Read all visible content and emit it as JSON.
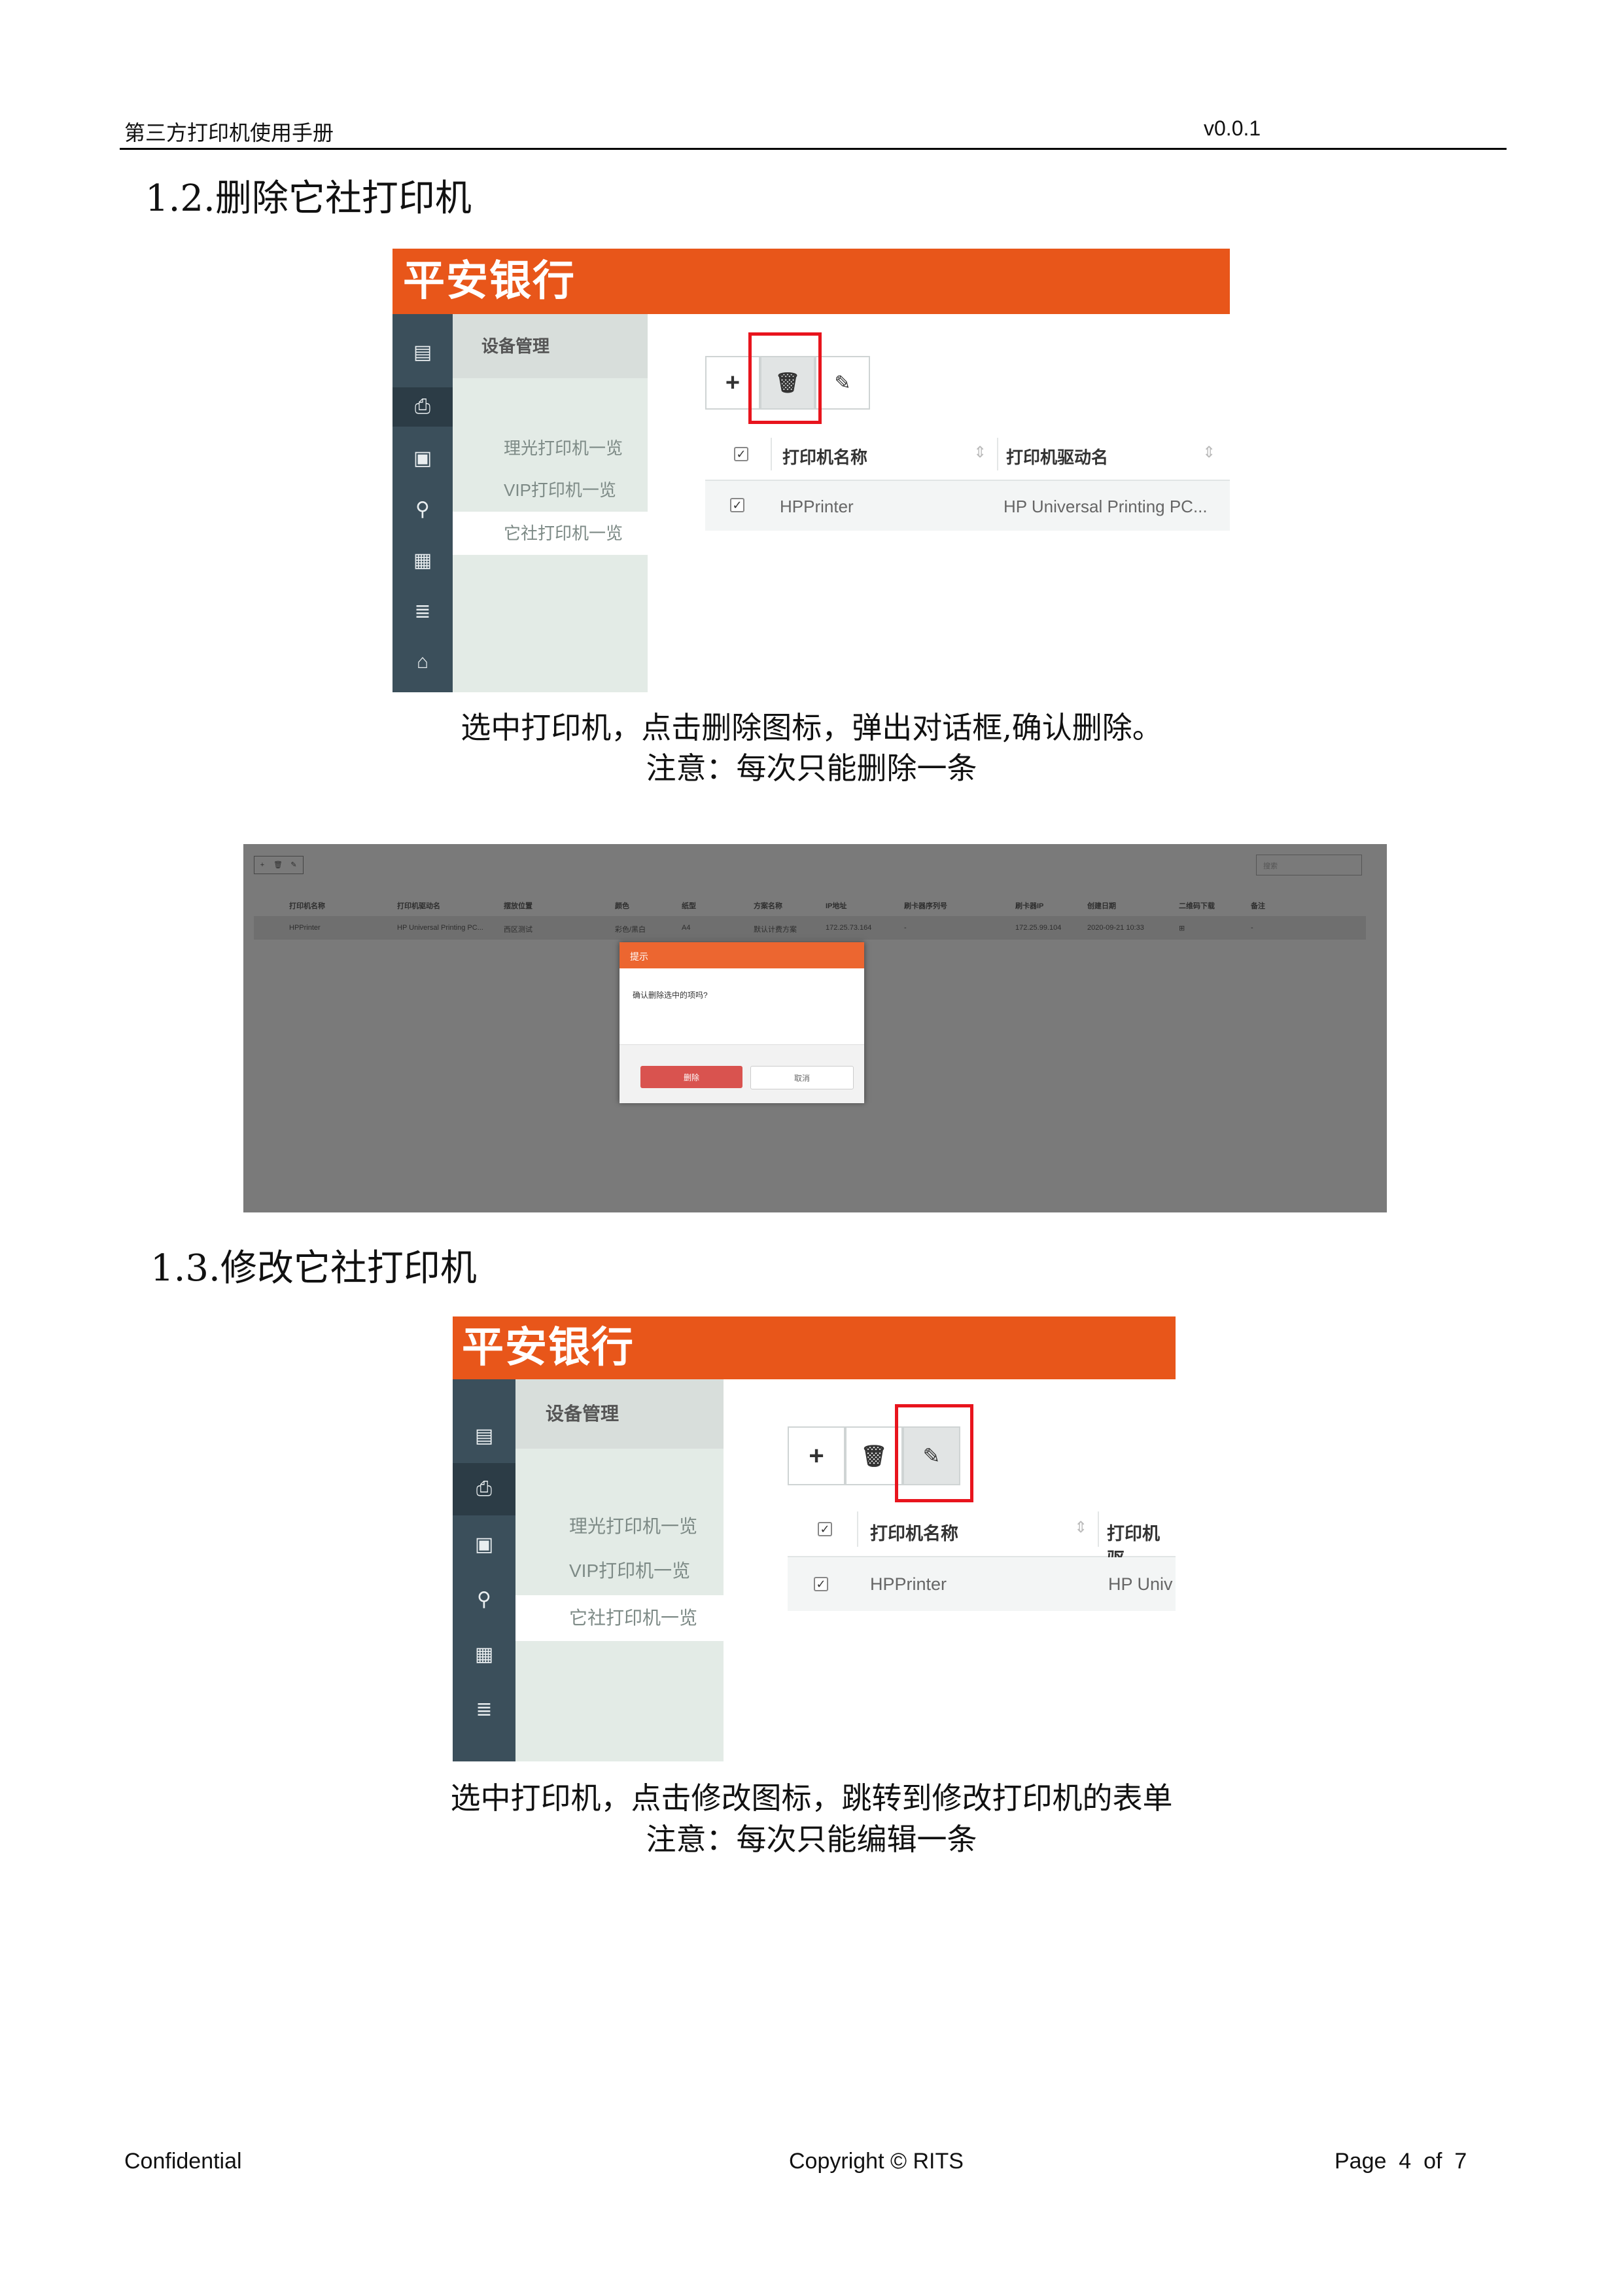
{
  "header": {
    "manual_title": "第三方打印机使用手册",
    "version": "v0.0.1"
  },
  "section_delete": {
    "heading": "1.2.删除它社打印机",
    "caption_line1": "选中打印机，点击删除图标，弹出对话框,确认删除。",
    "caption_line2": "注意：每次只能删除一条"
  },
  "section_edit": {
    "heading": "1.3.修改它社打印机",
    "caption_line1": "选中打印机，点击修改图标，跳转到修改打印机的表单",
    "caption_line2": "注意：每次只能编辑一条"
  },
  "app": {
    "brand": "平安银行",
    "menu_header": "设备管理",
    "menu_items": [
      "理光打印机一览",
      "VIP打印机一览",
      "它社打印机一览"
    ],
    "toolbar": {
      "add": "+",
      "delete": "🗑",
      "edit": "✎"
    },
    "table_headers": [
      "打印机名称",
      "打印机驱动名"
    ],
    "row": {
      "name": "HPPrinter",
      "driver": "HP Universal Printing PC..."
    },
    "edit_shot_header_trunc": "打印机驱",
    "edit_shot_driver_trunc": "HP Univ"
  },
  "dialog_shot": {
    "search_placeholder": "搜索",
    "headers": [
      "打印机名称",
      "打印机驱动名",
      "摆放位置",
      "颜色",
      "纸型",
      "方案名称",
      "IP地址",
      "刷卡器序列号",
      "刷卡器IP",
      "创建日期",
      "二维码下载",
      "备注"
    ],
    "row": [
      "HPPrinter",
      "HP Universal Printing PC...",
      "西区测试",
      "彩色/黑白",
      "A4",
      "默认计费方案",
      "172.25.73.164",
      "-",
      "172.25.99.104",
      "2020-09-21 10:33",
      "",
      "-"
    ],
    "dialog_title": "提示",
    "dialog_message": "确认删除选中的项吗?",
    "confirm": "删除",
    "cancel": "取消"
  },
  "footer": {
    "left": "Confidential",
    "center": "Copyright © RITS",
    "right": "Page  4  of  7"
  },
  "colors": {
    "brand_orange": "#e8561a",
    "highlight_red": "#e8141d",
    "nav_dark": "#3b4f5b"
  }
}
